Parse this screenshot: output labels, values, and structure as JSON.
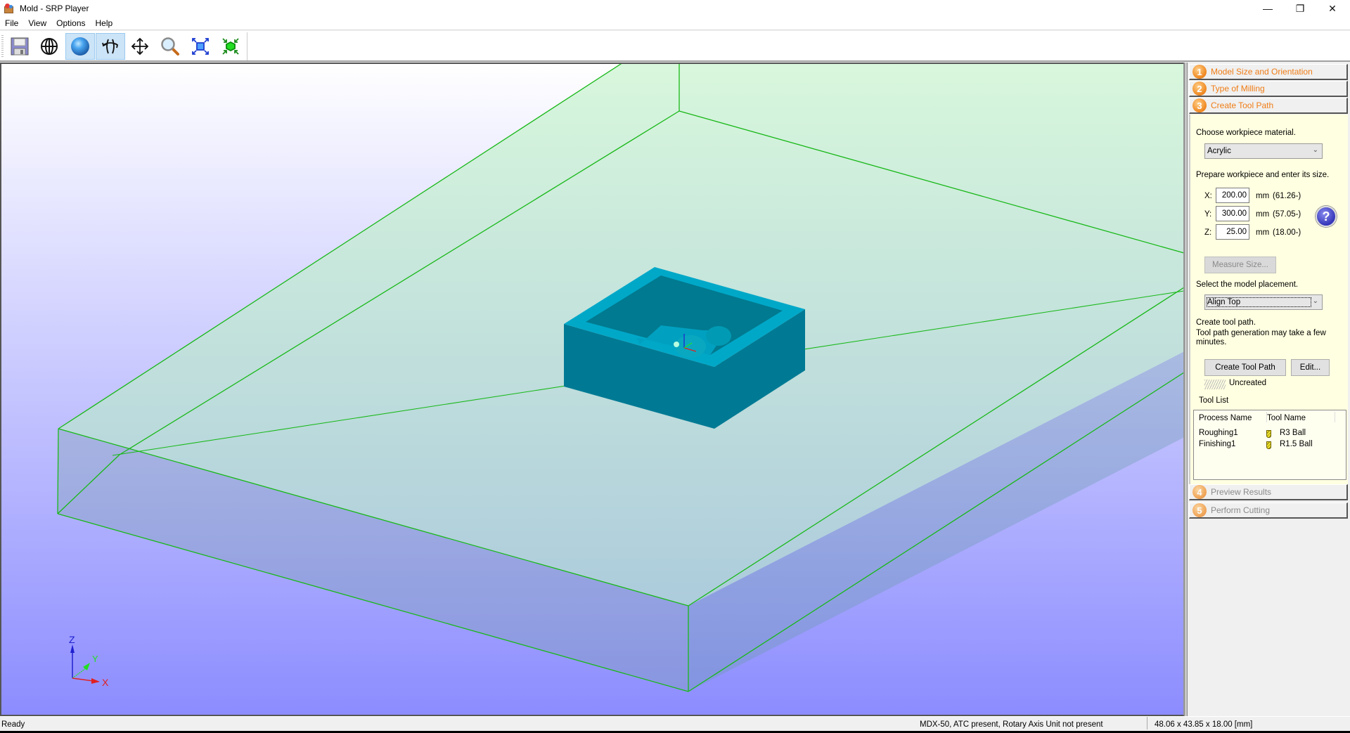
{
  "window": {
    "title": "Mold - SRP Player",
    "minimize_glyph": "—",
    "restore_glyph": "❐",
    "close_glyph": "✕"
  },
  "menu": [
    "File",
    "View",
    "Options",
    "Help"
  ],
  "toolbar": {
    "buttons": [
      {
        "name": "save-icon",
        "active": false
      },
      {
        "name": "wireframe-view-icon",
        "active": false
      },
      {
        "name": "shaded-view-icon",
        "active": true
      },
      {
        "name": "rotate-icon",
        "active": true
      },
      {
        "name": "pan-icon",
        "active": false
      },
      {
        "name": "zoom-icon",
        "active": false
      },
      {
        "name": "fit-view-icon",
        "active": false
      },
      {
        "name": "fit-model-icon",
        "active": false
      }
    ]
  },
  "viewport": {
    "background_top": "#ffffff",
    "background_bottom": "#8c8cff",
    "workpiece_edge_color": "#18b818",
    "model_color": "#0098b8",
    "axis_labels": {
      "x": "X",
      "y": "Y",
      "z": "Z"
    },
    "axis_colors": {
      "x": "#e02020",
      "y": "#20e020",
      "z": "#2020d0"
    }
  },
  "panel": {
    "steps": [
      {
        "number": "1",
        "label": "Model Size and Orientation",
        "enabled": true
      },
      {
        "number": "2",
        "label": "Type of Milling",
        "enabled": true
      },
      {
        "number": "3",
        "label": "Create Tool Path",
        "enabled": true
      },
      {
        "number": "4",
        "label": "Preview Results",
        "enabled": false
      },
      {
        "number": "5",
        "label": "Perform Cutting",
        "enabled": false
      }
    ],
    "material_prompt": "Choose workpiece material.",
    "material_value": "Acrylic",
    "size_prompt": "Prepare workpiece and enter its size.",
    "size": [
      {
        "axis": "X:",
        "value": "200.00",
        "unit": "mm",
        "min": "(61.26-)"
      },
      {
        "axis": "Y:",
        "value": "300.00",
        "unit": "mm",
        "min": "(57.05-)"
      },
      {
        "axis": "Z:",
        "value": "25.00",
        "unit": "mm",
        "min": "(18.00-)"
      }
    ],
    "help_glyph": "?",
    "measure_button": "Measure Size...",
    "placement_prompt": "Select the model placement.",
    "placement_value": "Align Top",
    "toolpath_prompt_1": "Create tool path.",
    "toolpath_prompt_2": "Tool path generation may take a few",
    "toolpath_prompt_3": "minutes.",
    "create_button": "Create Tool Path",
    "edit_button": "Edit...",
    "toolpath_status": "Uncreated",
    "tool_list_label": "Tool List",
    "tool_list_columns": [
      "Process Name",
      "Tool Name"
    ],
    "tool_list_rows": [
      {
        "process": "Roughing1",
        "tool": "R3 Ball"
      },
      {
        "process": "Finishing1",
        "tool": "R1.5 Ball"
      }
    ]
  },
  "status": {
    "ready": "Ready",
    "machine": "MDX-50, ATC present, Rotary Axis Unit not present",
    "model_size": "48.06 x  43.85 x  18.00 [mm]"
  }
}
